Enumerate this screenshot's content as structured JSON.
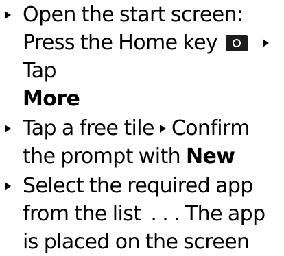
{
  "steps": [
    {
      "text_1": "Open the start screen: Press the Home key",
      "icon": "home-key-icon",
      "text_2": "Tap",
      "bold": "More"
    },
    {
      "text_1": "Tap a free tile",
      "text_2": "Confirm the prompt with",
      "bold": "New"
    },
    {
      "text_1": "Select the required app from the list",
      "ellipsis": ". . .",
      "text_2": "The app is placed on the screen"
    }
  ]
}
